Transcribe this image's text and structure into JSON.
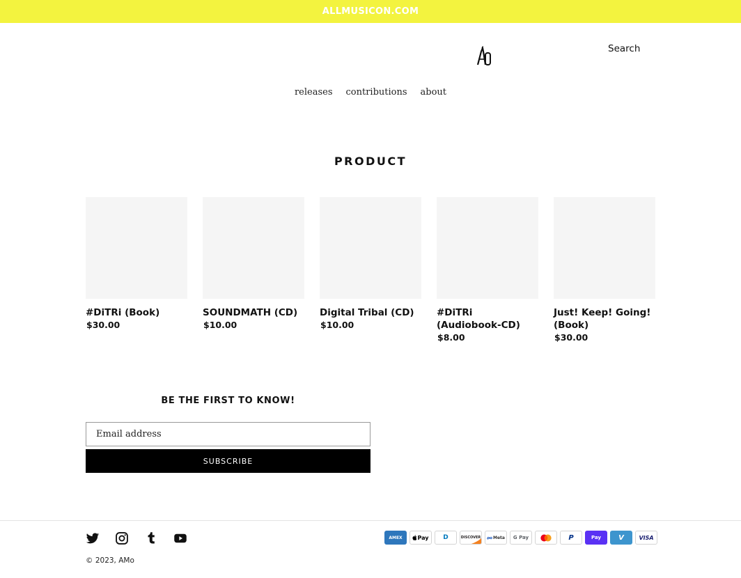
{
  "announcement": {
    "text": "ALLMUSICON.COM"
  },
  "header": {
    "search_label": "Search",
    "logo_mark": "AO"
  },
  "nav": {
    "items": [
      "releases",
      "contributions",
      "about"
    ]
  },
  "collection": {
    "title": "PRODUCT"
  },
  "products": [
    {
      "title": "#DiTRi (Book)",
      "price": "$30.00"
    },
    {
      "title": "SOUNDMATH (CD)",
      "price": "$10.00"
    },
    {
      "title": "Digital Tribal (CD)",
      "price": "$10.00"
    },
    {
      "title": "#DiTRi (Audiobook-CD)",
      "price": "$8.00"
    },
    {
      "title": "Just! Keep! Going! (Book)",
      "price": "$30.00"
    }
  ],
  "newsletter": {
    "title": "BE THE FIRST TO KNOW!",
    "placeholder": "Email address",
    "button_label": "SUBSCRIBE"
  },
  "social": [
    {
      "icon": "twitter-icon"
    },
    {
      "icon": "instagram-icon"
    },
    {
      "icon": "tumblr-icon"
    },
    {
      "icon": "youtube-icon"
    }
  ],
  "payments": [
    {
      "label": "AMEX",
      "bg": "#2e77bc",
      "fg": "#ffffff"
    },
    {
      "label": "Pay",
      "bg": "#ffffff",
      "fg": "#000000"
    },
    {
      "label": "D",
      "bg": "#ffffff",
      "fg": "#0079be"
    },
    {
      "label": "DISCOVER",
      "bg": "#ffffff",
      "fg": "#231f20"
    },
    {
      "label": "Meta",
      "bg": "#ffffff",
      "fg": "#1f5bbf"
    },
    {
      "label": "G Pay",
      "bg": "#ffffff",
      "fg": "#5f6368"
    },
    {
      "label": "",
      "bg": "#ffffff",
      "fg": "#000000"
    },
    {
      "label": "P",
      "bg": "#ffffff",
      "fg": "#003087"
    },
    {
      "label": "Pay",
      "bg": "#5a31f4",
      "fg": "#ffffff"
    },
    {
      "label": "V",
      "bg": "#3d95ce",
      "fg": "#ffffff"
    },
    {
      "label": "VISA",
      "bg": "#ffffff",
      "fg": "#1a1f71"
    }
  ],
  "footer": {
    "copyright_prefix": "© 2023, ",
    "brand": "AMo"
  },
  "colors": {
    "announcement_bg": "#f3f33f",
    "button_bg": "#000000",
    "placeholder_bg": "#f5f5f5"
  }
}
